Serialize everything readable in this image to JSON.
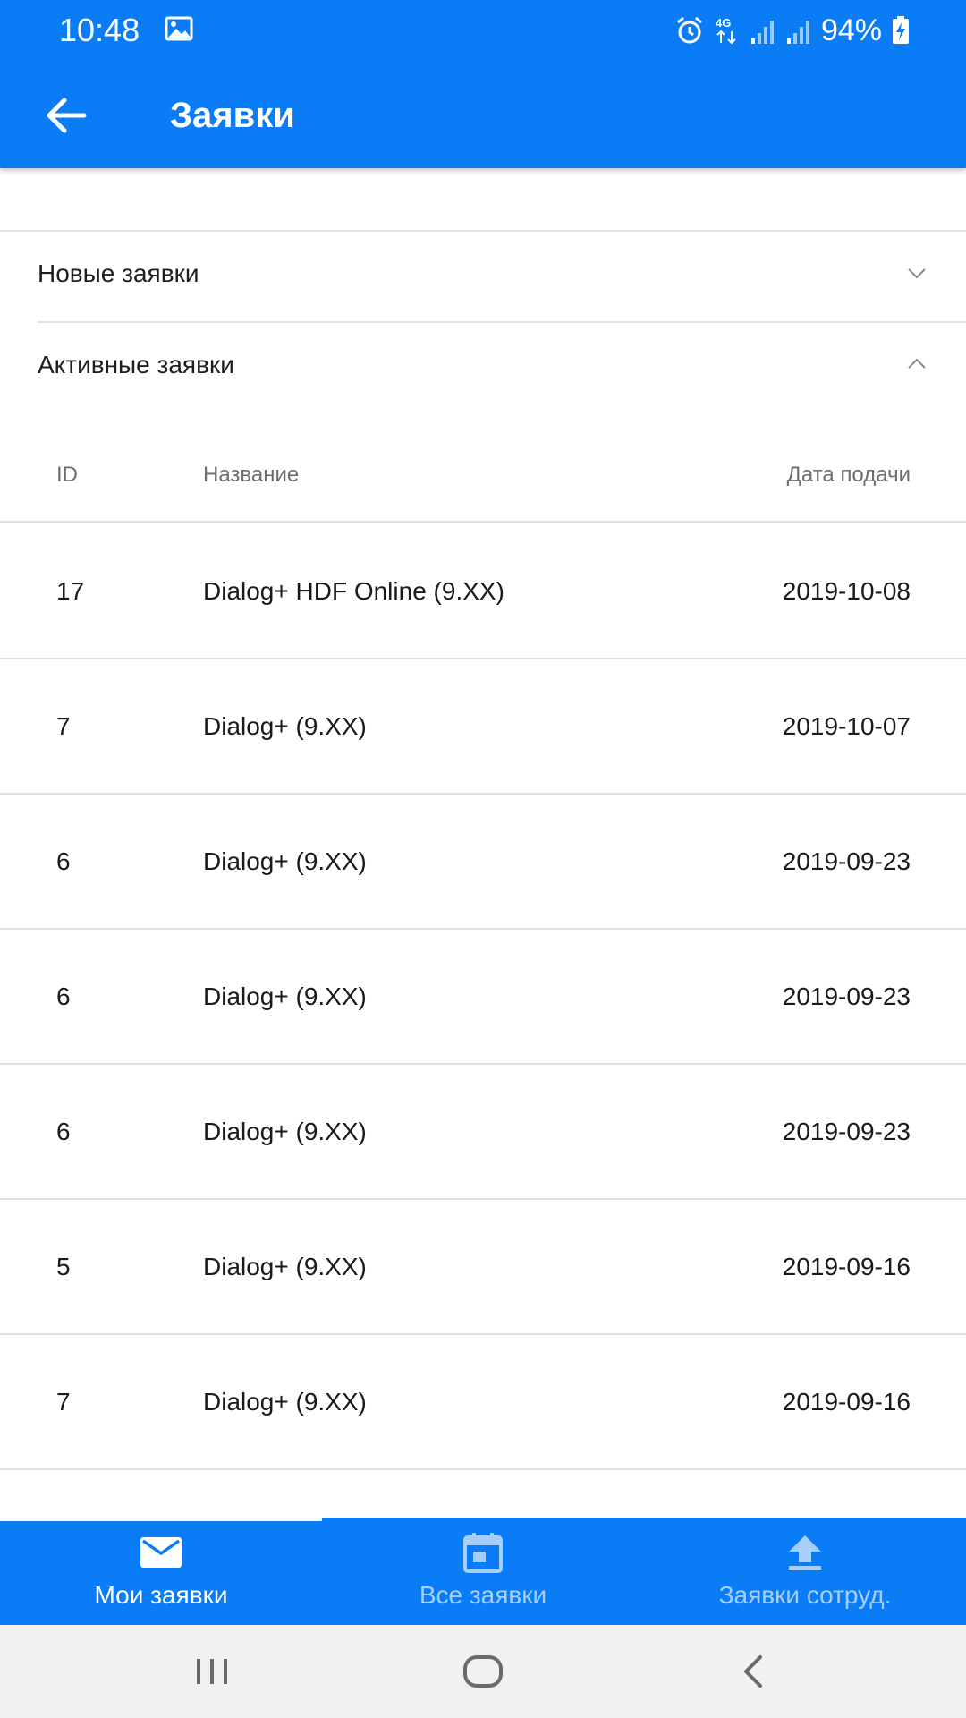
{
  "status_bar": {
    "time": "10:48",
    "left_icon": "image-icon",
    "right_icons": [
      "alarm-icon",
      "4g-icon",
      "signal-icon",
      "signal-icon"
    ],
    "network_label": "4G",
    "battery_percent": "94%",
    "battery_icon": "battery-charging-icon"
  },
  "app_bar": {
    "back_icon": "arrow-left-icon",
    "title": "Заявки",
    "color": "#0a7cf5"
  },
  "sections": {
    "new": {
      "label": "Новые заявки",
      "expanded": false
    },
    "active": {
      "label": "Активные заявки",
      "expanded": true
    }
  },
  "table": {
    "headers": {
      "id": "ID",
      "name": "Название",
      "date": "Дата подачи"
    },
    "rows": [
      {
        "id": "17",
        "name": "Dialog+ HDF Online (9.XX)",
        "date": "2019-10-08"
      },
      {
        "id": "7",
        "name": "Dialog+ (9.XX)",
        "date": "2019-10-07"
      },
      {
        "id": "6",
        "name": "Dialog+ (9.XX)",
        "date": "2019-09-23"
      },
      {
        "id": "6",
        "name": "Dialog+ (9.XX)",
        "date": "2019-09-23"
      },
      {
        "id": "6",
        "name": "Dialog+ (9.XX)",
        "date": "2019-09-23"
      },
      {
        "id": "5",
        "name": "Dialog+ (9.XX)",
        "date": "2019-09-16"
      },
      {
        "id": "7",
        "name": "Dialog+ (9.XX)",
        "date": "2019-09-16"
      }
    ]
  },
  "bottom_nav": {
    "tabs": [
      {
        "label": "Мои заявки",
        "icon": "mail-icon",
        "active": true
      },
      {
        "label": "Все заявки",
        "icon": "calendar-icon",
        "active": false
      },
      {
        "label": "Заявки сотруд.",
        "icon": "upload-icon",
        "active": false
      }
    ],
    "active_color": "#ffffff",
    "inactive_color": "#a7cdf9"
  },
  "system_nav": {
    "buttons": [
      "recents-icon",
      "home-icon",
      "back-icon"
    ]
  }
}
